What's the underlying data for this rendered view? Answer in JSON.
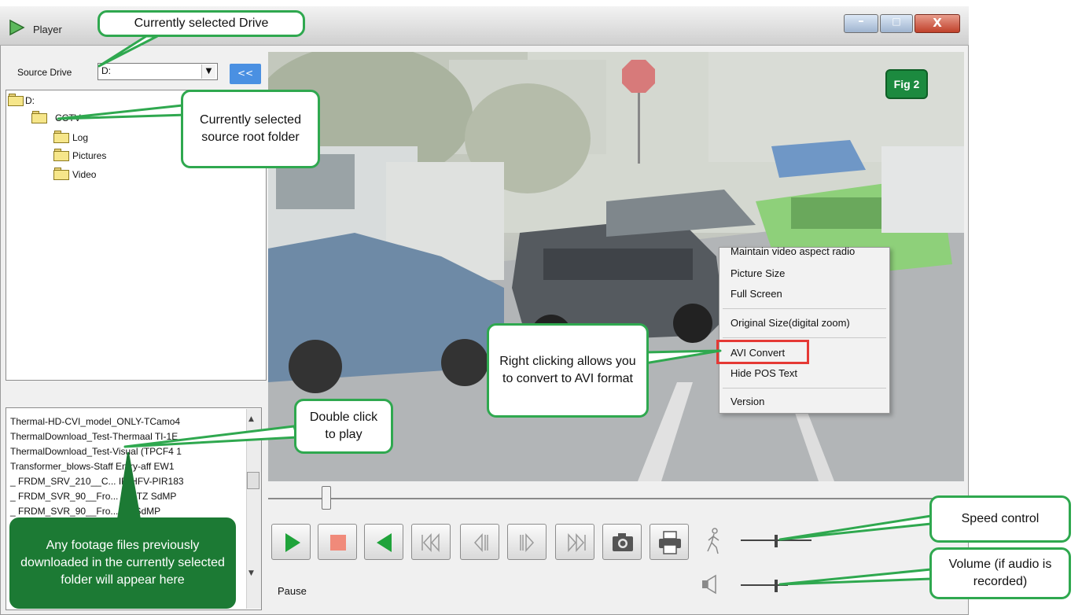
{
  "window": {
    "title": "Player",
    "minimize": "–",
    "maximize": "□",
    "close": "X"
  },
  "left": {
    "source_drive_label": "Source Drive",
    "source_drive_value": "D:",
    "collapse_label": "<<",
    "tree": [
      {
        "label": "D:"
      },
      {
        "label": "CCTV"
      },
      {
        "label": "Log"
      },
      {
        "label": "Pictures"
      },
      {
        "label": "Video"
      }
    ],
    "files": [
      "Thermal-HD-CVI_model_ONLY-TCamo4",
      "ThermalDownload_Test-Thermaal TI-1E",
      "ThermalDownload_Test-Visual (TPCF4 1",
      "Transformer_blows-Staff Entry-aff EW1",
      "_ FRDM_SRV_210__C... IP-HFV-PIR183",
      "_ FRDM_SVR_90__Fro... R STZ SdMP",
      "_ FRDM_SVR_90__Fro... TZ SdMP"
    ]
  },
  "video": {
    "fig_label": "Fig 2"
  },
  "context_menu": {
    "items": [
      "Maintain video aspect radio",
      "Picture Size",
      "Full Screen",
      "Original Size(digital zoom)",
      "AVI Convert",
      "Hide POS Text",
      "Version"
    ]
  },
  "controls": {
    "status": "Pause"
  },
  "callouts": {
    "drive": "Currently selected Drive",
    "root_folder": "Currently selected source root folder",
    "double_click": "Double click to play",
    "footage": "Any footage files previously downloaded in the currently selected folder will appear here",
    "avi": "Right clicking allows you to convert to AVI format",
    "speed": "Speed control",
    "volume": "Volume (if audio is recorded)"
  },
  "colors": {
    "callout_border": "#2fa84f",
    "callout_dark": "#1c7a34",
    "highlight": "#e53935",
    "collapse_button": "#4a90e2"
  }
}
